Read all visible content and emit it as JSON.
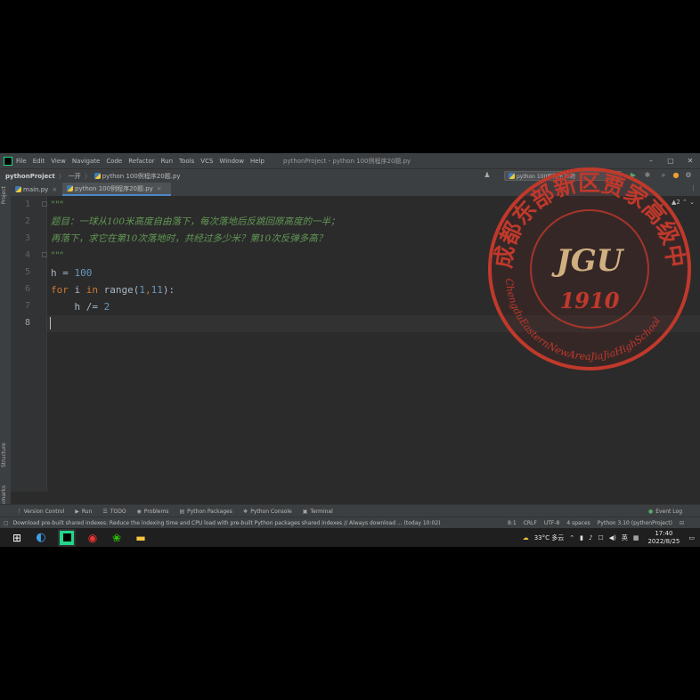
{
  "menu": {
    "items": [
      "File",
      "Edit",
      "View",
      "Navigate",
      "Code",
      "Refactor",
      "Run",
      "Tools",
      "VCS",
      "Window",
      "Help"
    ],
    "window_title": "pythonProject - python 100例程序20题.py"
  },
  "window_controls": {
    "minimize": "–",
    "maximize": "▢",
    "close": "✕"
  },
  "navbar": {
    "project": "pythonProject",
    "sep": "〉",
    "folder": "一开",
    "file": "python 100例程序20题.py",
    "run_config": "python 100例程序20题"
  },
  "tabs": [
    {
      "label": "main.py",
      "close": "×"
    },
    {
      "label": "python 100例程序20题.py",
      "close": "×"
    }
  ],
  "left_strip": {
    "project": "Project",
    "structure": "Structure",
    "bookmarks": "Bookmarks"
  },
  "editor": {
    "line_numbers": [
      "1",
      "2",
      "3",
      "4",
      "5",
      "6",
      "7",
      "8"
    ],
    "current_line": 8,
    "lines": {
      "l1": "\"\"\"",
      "l2": "题目：一球从100米高度自由落下，每次落地后反跳回原高度的一半；",
      "l3": "再落下，求它在第10次落地时，共经过多少米？第10次反弹多高？",
      "l4": "\"\"\"",
      "l5_var": "h",
      "l5_op": " = ",
      "l5_num": "100",
      "l6_for": "for",
      "l6_i": " i ",
      "l6_in": "in",
      "l6_range": " range(",
      "l6_a": "1",
      "l6_comma": ",",
      "l6_b": "11",
      "l6_end": "):",
      "l7_pre": "    h /= ",
      "l7_num": "2"
    },
    "inspection": "▲2  ⌃  ⌄"
  },
  "tool_windows": [
    "Version Control",
    "Run",
    "TODO",
    "Problems",
    "Python Packages",
    "Python Console",
    "Terminal"
  ],
  "event_log": "Event Log",
  "status": {
    "message": "Download pre-built shared indexes: Reduce the indexing time and CPU load with pre-built Python packages shared indexes // Always download ... (today 10:02)",
    "position": "8:1",
    "line_sep": "CRLF",
    "encoding": "UTF-8",
    "indent": "4 spaces",
    "interpreter": "Python 3.10 (pythonProject)"
  },
  "taskbar": {
    "weather": "33°C 多云",
    "ime": "英",
    "time": "17:40",
    "date": "2022/8/25"
  },
  "stamp": {
    "arc_text": "成都东部新区贾家高级中学",
    "logo": "JGU",
    "year": "1910",
    "bottom_text": "ChengduEasternNewAreaJiaJiaHighSchool"
  },
  "colors": {
    "editor_bg": "#2b2b2b",
    "keyword": "#cc7832",
    "number": "#6897bb",
    "docstring": "#629755",
    "stamp_red": "#c0392b"
  }
}
